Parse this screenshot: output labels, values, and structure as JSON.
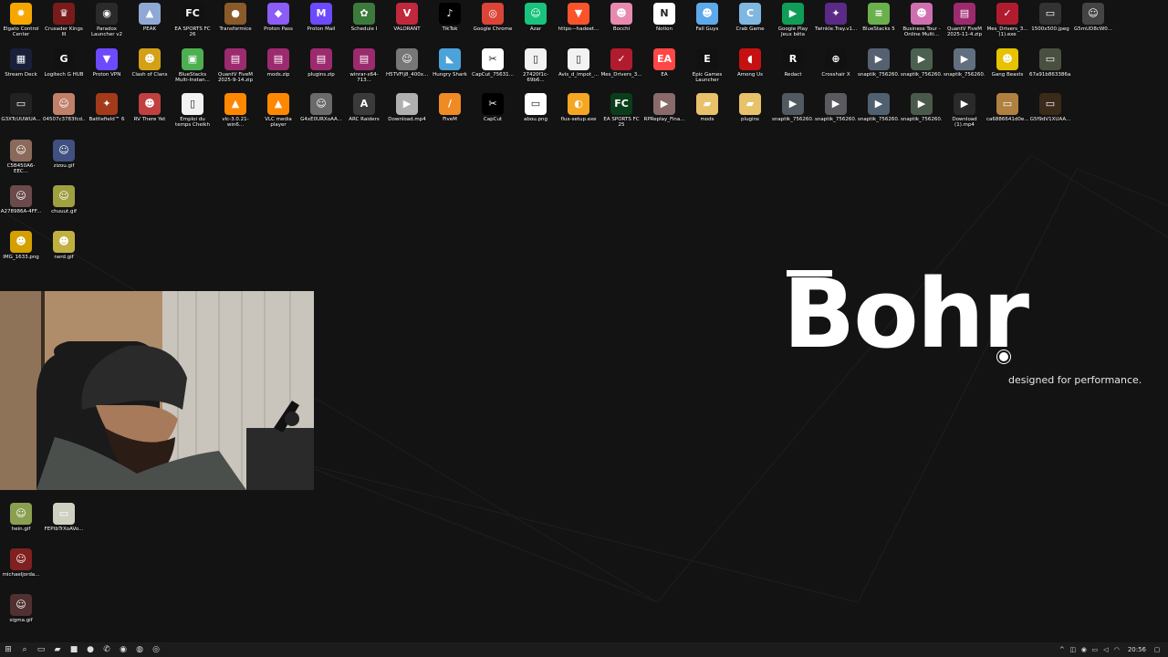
{
  "desktop": {
    "rows": [
      [
        {
          "label": "Elgato Control Center",
          "icon": "elgato-icon",
          "color": "#f7a600",
          "glyph": "✹"
        },
        {
          "label": "Crusader Kings III",
          "icon": "crusader-kings-icon",
          "color": "#7a1b1b",
          "glyph": "♛"
        },
        {
          "label": "Paradox Launcher v2",
          "icon": "paradox-icon",
          "color": "#2a2a2a",
          "glyph": "◉"
        },
        {
          "label": "PEAK",
          "icon": "peak-icon",
          "color": "#8fa9d6",
          "glyph": "▲"
        },
        {
          "label": "EA SPORTS FC 26",
          "icon": "ea-fc-icon",
          "color": "#111111",
          "glyph": "FC"
        },
        {
          "label": "Transformice",
          "icon": "transformice-icon",
          "color": "#8a5a2b",
          "glyph": "●"
        },
        {
          "label": "Proton Pass",
          "icon": "proton-pass-icon",
          "color": "#8b5cf6",
          "glyph": "◆"
        },
        {
          "label": "Proton Mail",
          "icon": "proton-mail-icon",
          "color": "#6d4aff",
          "glyph": "M"
        },
        {
          "label": "Schedule I",
          "icon": "schedule-icon",
          "color": "#3c7a3c",
          "glyph": "✿"
        },
        {
          "label": "VALORANT",
          "icon": "valorant-icon",
          "color": "#c0283e",
          "glyph": "V"
        },
        {
          "label": "TikTok",
          "icon": "tiktok-icon",
          "color": "#000000",
          "glyph": "♪"
        },
        {
          "label": "Google Chrome",
          "icon": "chrome-icon",
          "color": "#db4437",
          "glyph": "◎"
        },
        {
          "label": "Azar",
          "icon": "azar-icon",
          "color": "#19c37d",
          "glyph": "☺"
        },
        {
          "label": "https---hadeet...",
          "icon": "brave-icon",
          "color": "#fb542b",
          "glyph": "▼"
        },
        {
          "label": "Bocchi",
          "icon": "bocchi-icon",
          "color": "#e88ab0",
          "glyph": "☻"
        },
        {
          "label": "Notion",
          "icon": "notion-icon",
          "color": "#ffffff",
          "glyph": "N"
        },
        {
          "label": "Fall Guys",
          "icon": "fall-guys-icon",
          "color": "#5da9e9",
          "glyph": "☻"
        },
        {
          "label": "Crab Game",
          "icon": "crab-game-icon",
          "color": "#7fb7e0",
          "glyph": "C"
        },
        {
          "label": "Google Play Jeux bêta",
          "icon": "google-play-icon",
          "color": "#0f9d58",
          "glyph": "▶"
        },
        {
          "label": "Twinkle.Tray.v1...",
          "icon": "twinkle-tray-icon",
          "color": "#5b2a86",
          "glyph": "✦"
        },
        {
          "label": "BlueStacks 5",
          "icon": "bluestacks-icon",
          "color": "#6ab04c",
          "glyph": "≡"
        },
        {
          "label": "Business Tour - Online Multi...",
          "icon": "business-tour-icon",
          "color": "#d06fb0",
          "glyph": "☻"
        },
        {
          "label": "QuantV FiveM 2025-11-4.zip",
          "icon": "winrar-icon",
          "color": "#9c2a6e",
          "glyph": "▤"
        },
        {
          "label": "Mes_Drivers_3... (1).exe",
          "icon": "drivers-exe-icon",
          "color": "#b01c2e",
          "glyph": "✓"
        },
        {
          "label": "1500x500.jpeg",
          "icon": "image-file-icon",
          "color": "#333333",
          "glyph": "▭"
        },
        {
          "label": "G5mUD8cW0...",
          "icon": "image-file-icon",
          "color": "#444444",
          "glyph": "☺"
        }
      ],
      [
        {
          "label": "Stream Deck",
          "icon": "stream-deck-icon",
          "color": "#1a1f3a",
          "glyph": "▦"
        },
        {
          "label": "Logitech G HUB",
          "icon": "logitech-icon",
          "color": "#111111",
          "glyph": "G"
        },
        {
          "label": "Proton VPN",
          "icon": "proton-vpn-icon",
          "color": "#6d4aff",
          "glyph": "▼"
        },
        {
          "label": "Clash of Clans",
          "icon": "clash-icon",
          "color": "#d4a017",
          "glyph": "☻"
        },
        {
          "label": "BlueStacks Multi-Instan...",
          "icon": "bluestacks-icon",
          "color": "#4caf50",
          "glyph": "▣"
        },
        {
          "label": "QuantV FiveM 2025-9-14.zip",
          "icon": "winrar-icon",
          "color": "#9c2a6e",
          "glyph": "▤"
        },
        {
          "label": "mods.zip",
          "icon": "winrar-icon",
          "color": "#9c2a6e",
          "glyph": "▤"
        },
        {
          "label": "plugins.zip",
          "icon": "winrar-icon",
          "color": "#9c2a6e",
          "glyph": "▤"
        },
        {
          "label": "winrar-x64-713...",
          "icon": "winrar-icon",
          "color": "#9c2a6e",
          "glyph": "▤"
        },
        {
          "label": "H5TVFlj8_400x...",
          "icon": "image-file-icon",
          "color": "#777777",
          "glyph": "☺"
        },
        {
          "label": "Hungry Shark",
          "icon": "hungry-shark-icon",
          "color": "#4ba3d9",
          "glyph": "◣"
        },
        {
          "label": "CapCut_75631...",
          "icon": "capcut-icon",
          "color": "#ffffff",
          "glyph": "✂"
        },
        {
          "label": "27420f1c-69b6...",
          "icon": "file-icon",
          "color": "#f2f2f2",
          "glyph": "▯"
        },
        {
          "label": "Avis_d_impot_...",
          "icon": "file-icon",
          "color": "#f2f2f2",
          "glyph": "▯"
        },
        {
          "label": "Mes_Drivers_3...",
          "icon": "drivers-exe-icon",
          "color": "#b01c2e",
          "glyph": "✓"
        },
        {
          "label": "EA",
          "icon": "ea-icon",
          "color": "#ff4747",
          "glyph": "EA"
        },
        {
          "label": "Epic Games Launcher",
          "icon": "epic-icon",
          "color": "#111111",
          "glyph": "E"
        },
        {
          "label": "Among Us",
          "icon": "among-us-icon",
          "color": "#c51111",
          "glyph": "◖"
        },
        {
          "label": "Redact",
          "icon": "redact-icon",
          "color": "#111111",
          "glyph": "R"
        },
        {
          "label": "Crosshair X",
          "icon": "crosshair-icon",
          "color": "#111111",
          "glyph": "⊕"
        },
        {
          "label": "snaptik_756260...",
          "icon": "video-file-icon",
          "color": "#556070",
          "glyph": "▶"
        },
        {
          "label": "snaptik_756260...",
          "icon": "video-file-icon",
          "color": "#4c6050",
          "glyph": "▶"
        },
        {
          "label": "snaptik_756260...",
          "icon": "video-file-icon",
          "color": "#607080",
          "glyph": "▶"
        },
        {
          "label": "Gang Beasts",
          "icon": "gang-beasts-icon",
          "color": "#e6c200",
          "glyph": "☻"
        },
        {
          "label": "67a91b863386a...",
          "icon": "image-file-icon",
          "color": "#4a5040",
          "glyph": "▭"
        }
      ],
      [
        {
          "label": "G3XTcUUWUA...",
          "icon": "image-file-icon",
          "color": "#222222",
          "glyph": "▭"
        },
        {
          "label": "04507c3783fcd...",
          "icon": "image-file-icon",
          "color": "#c0806a",
          "glyph": "☺"
        },
        {
          "label": "Battlefield™ 6",
          "icon": "battlefield-icon",
          "color": "#a33a1a",
          "glyph": "✦"
        },
        {
          "label": "RV There Yet",
          "icon": "rv-icon",
          "color": "#c04040",
          "glyph": "☻"
        },
        {
          "label": "Emploi du temps Cheikh Soufian...",
          "icon": "file-icon",
          "color": "#f2f2f2",
          "glyph": "▯"
        },
        {
          "label": "vlc-3.0.21-win6...",
          "icon": "vlc-icon",
          "color": "#ff8800",
          "glyph": "▲"
        },
        {
          "label": "VLC media player",
          "icon": "vlc-icon",
          "color": "#ff8800",
          "glyph": "▲"
        },
        {
          "label": "G4xE0URXoAA...",
          "icon": "image-file-icon",
          "color": "#6a6a6a",
          "glyph": "☺"
        },
        {
          "label": "ARC Raiders",
          "icon": "arc-raiders-icon",
          "color": "#3a3a3a",
          "glyph": "A"
        },
        {
          "label": "Download.mp4",
          "icon": "video-file-icon",
          "color": "#b0b0b0",
          "glyph": "▶"
        },
        {
          "label": "FiveM",
          "icon": "fivem-icon",
          "color": "#f08a24",
          "glyph": "/"
        },
        {
          "label": "CapCut",
          "icon": "capcut-icon",
          "color": "#000000",
          "glyph": "✂"
        },
        {
          "label": "abou.png",
          "icon": "image-file-icon",
          "color": "#ffffff",
          "glyph": "▭"
        },
        {
          "label": "flux-setup.exe",
          "icon": "flux-icon",
          "color": "#f5a623",
          "glyph": "◐"
        },
        {
          "label": "EA SPORTS FC 25",
          "icon": "ea-fc-icon",
          "color": "#0a3d1a",
          "glyph": "FC"
        },
        {
          "label": "RPReplay_Fina...",
          "icon": "video-file-icon",
          "color": "#8a6a6a",
          "glyph": "▶"
        },
        {
          "label": "mods",
          "icon": "folder-icon",
          "color": "#e8c26a",
          "glyph": "▰"
        },
        {
          "label": "plugins",
          "icon": "folder-icon",
          "color": "#e8c26a",
          "glyph": "▰"
        },
        {
          "label": "snaptik_756260...",
          "icon": "video-file-icon",
          "color": "#505a60",
          "glyph": "▶"
        },
        {
          "label": "snaptik_756260...",
          "icon": "video-file-icon",
          "color": "#5a5a60",
          "glyph": "▶"
        },
        {
          "label": "snaptik_756260...",
          "icon": "video-file-icon",
          "color": "#506070",
          "glyph": "▶"
        },
        {
          "label": "snaptik_756260...",
          "icon": "video-file-icon",
          "color": "#4a5a4a",
          "glyph": "▶"
        },
        {
          "label": "Download (1).mp4",
          "icon": "video-file-icon",
          "color": "#2a2a2a",
          "glyph": "▶"
        },
        {
          "label": "ca6886641d0e...",
          "icon": "image-file-icon",
          "color": "#b08040",
          "glyph": "▭"
        },
        {
          "label": "G5f9dV1XUAA...",
          "icon": "image-file-icon",
          "color": "#3a2a1a",
          "glyph": "▭"
        }
      ]
    ],
    "left_column": [
      {
        "label": "C5B450A6-EEC...",
        "icon": "image-file-icon",
        "color": "#8a6a5a",
        "glyph": "☺",
        "row": 3,
        "col": 0
      },
      {
        "label": "zizou.gif",
        "icon": "gif-file-icon",
        "color": "#405080",
        "glyph": "☺",
        "row": 3,
        "col": 1
      },
      {
        "label": "A278986A-4FF...",
        "icon": "image-file-icon",
        "color": "#6a4a4a",
        "glyph": "☺",
        "row": 4,
        "col": 0
      },
      {
        "label": "chuuut.gif",
        "icon": "gif-file-icon",
        "color": "#a0a040",
        "glyph": "☺",
        "row": 4,
        "col": 1
      },
      {
        "label": "IMG_1633.png",
        "icon": "image-file-icon",
        "color": "#d4a000",
        "glyph": "☻",
        "row": 5,
        "col": 0
      },
      {
        "label": "nerd.gif",
        "icon": "gif-file-icon",
        "color": "#c0b040",
        "glyph": "☻",
        "row": 5,
        "col": 1
      },
      {
        "label": "hein.gif",
        "icon": "gif-file-icon",
        "color": "#8aa050",
        "glyph": "☺",
        "row": 11,
        "col": 0
      },
      {
        "label": "FEPtbTrXoAVo...",
        "icon": "image-file-icon",
        "color": "#d0d0c0",
        "glyph": "▭",
        "row": 11,
        "col": 1
      },
      {
        "label": "michaeljorda...",
        "icon": "image-file-icon",
        "color": "#802020",
        "glyph": "☺",
        "row": 12,
        "col": 0
      },
      {
        "label": "sigma.gif",
        "icon": "gif-file-icon",
        "color": "#503030",
        "glyph": "☺",
        "row": 13,
        "col": 0
      }
    ]
  },
  "wallpaper": {
    "brand": "Bohr",
    "tagline": "designed for performance."
  },
  "taskbar": {
    "items": [
      {
        "name": "start-button",
        "icon": "windows-icon",
        "glyph": "⊞"
      },
      {
        "name": "search-button",
        "icon": "search-icon",
        "glyph": "⌕"
      },
      {
        "name": "task-view-button",
        "icon": "task-view-icon",
        "glyph": "▭"
      },
      {
        "name": "file-explorer-button",
        "icon": "folder-icon",
        "glyph": "▰"
      },
      {
        "name": "app-red-button",
        "icon": "app-icon",
        "glyph": "■"
      },
      {
        "name": "app-blue-button",
        "icon": "app-icon",
        "glyph": "●"
      },
      {
        "name": "whatsapp-button",
        "icon": "whatsapp-icon",
        "glyph": "✆"
      },
      {
        "name": "spotify-button",
        "icon": "spotify-icon",
        "glyph": "◉"
      },
      {
        "name": "discord-button",
        "icon": "discord-icon",
        "glyph": "◍"
      },
      {
        "name": "obs-button",
        "icon": "obs-icon",
        "glyph": "◎"
      }
    ],
    "tray": {
      "clock": "20:56"
    }
  }
}
